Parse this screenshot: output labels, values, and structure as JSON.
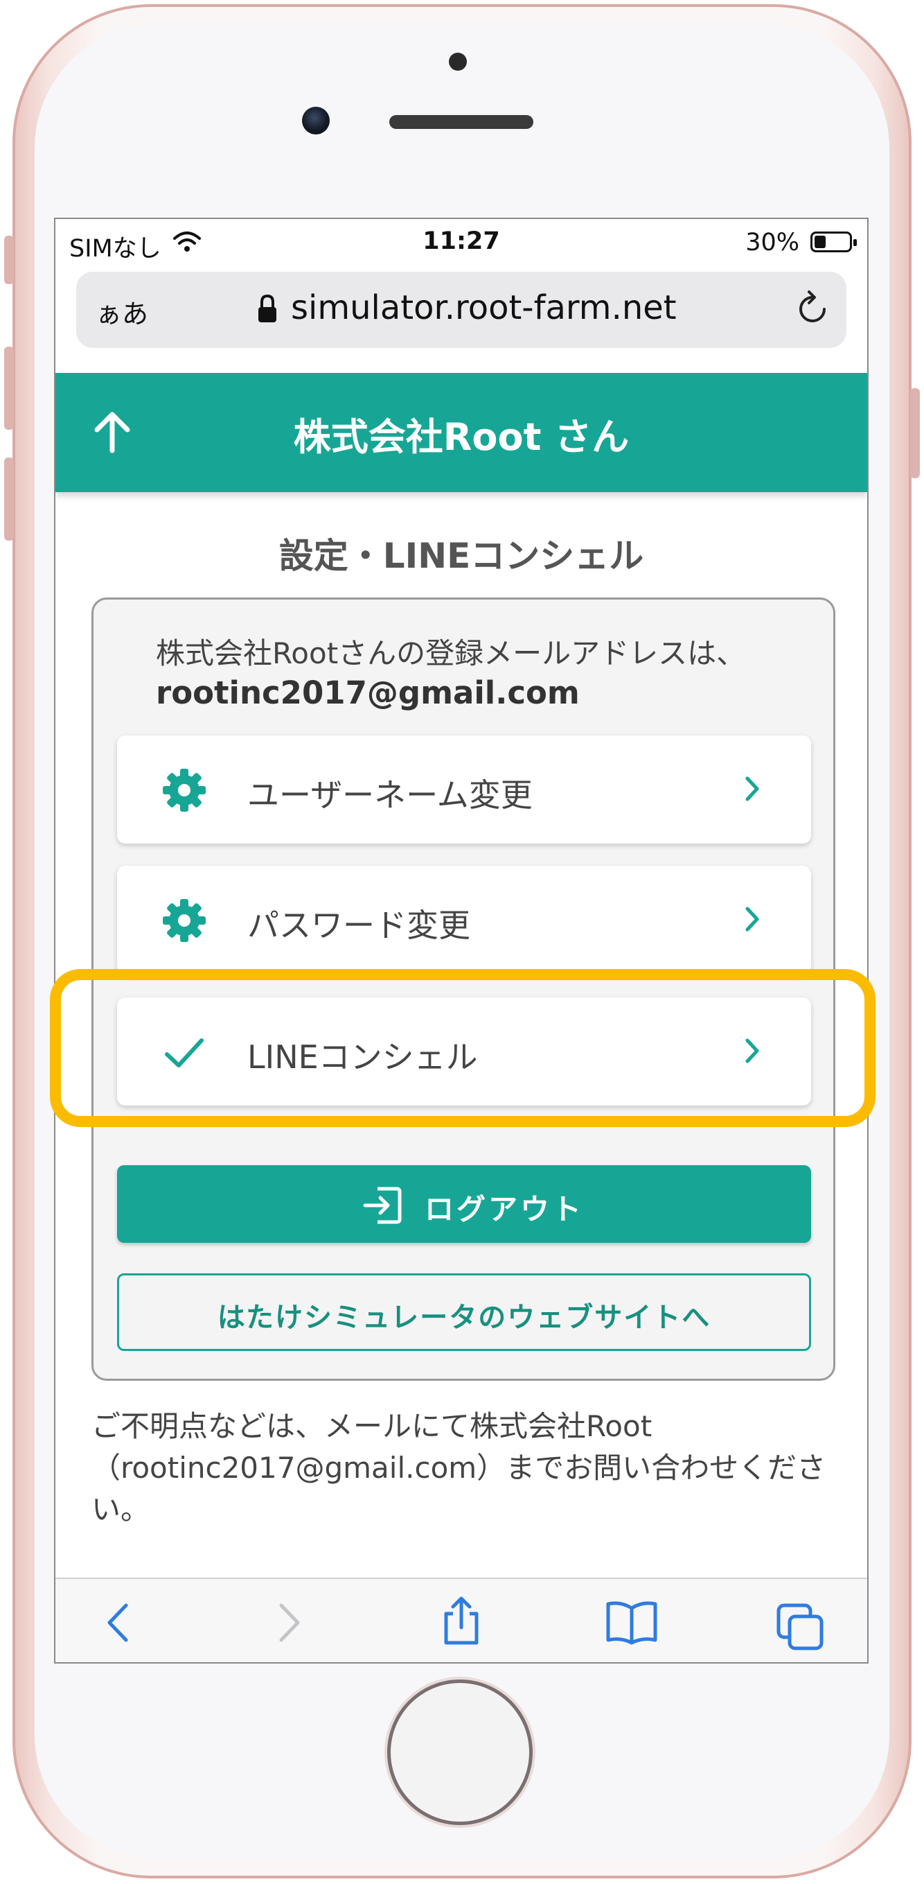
{
  "status_bar": {
    "carrier": "SIMなし",
    "time": "11:27",
    "battery": "30%",
    "battery_level": 0.3
  },
  "browser": {
    "text_size_button": "ぁあ",
    "url": "simulator.root-farm.net",
    "reload_icon": "reload-icon",
    "lock_icon": "lock-icon"
  },
  "app_bar": {
    "title": "株式会社Root さん",
    "back_icon": "arrow-up-icon"
  },
  "page": {
    "section_title": "設定・LINEコンシェル",
    "email_lead": "株式会社Rootさんの登録メールアドレスは、",
    "email": "rootinc2017@gmail.com",
    "menu": [
      {
        "label": "ユーザーネーム変更",
        "icon": "gear-icon"
      },
      {
        "label": "パスワード変更",
        "icon": "gear-icon"
      },
      {
        "label": "LINEコンシェル",
        "icon": "check-icon"
      }
    ],
    "logout_label": "ログアウト",
    "website_label": "はたけシミュレータのウェブサイトへ",
    "footer_note": "ご不明点などは、メールにて株式会社Root（rootinc2017@gmail.com）までお問い合わせください。"
  },
  "toolbar": {
    "items": [
      "back-icon",
      "forward-icon",
      "share-icon",
      "bookmarks-icon",
      "tabs-icon"
    ]
  },
  "colors": {
    "accent": "#17a695",
    "highlight": "#fbbb00",
    "ios_blue": "#2f7ce0"
  }
}
